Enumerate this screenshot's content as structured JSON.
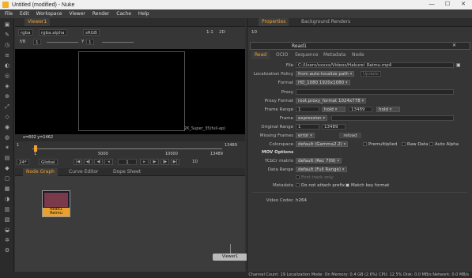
{
  "window": {
    "title": "Untitled (modified) - Nuke",
    "min": "—",
    "max": "☐",
    "close": "✕"
  },
  "menu": [
    "File",
    "Edit",
    "Workspace",
    "Viewer",
    "Render",
    "Cache",
    "Help"
  ],
  "viewer": {
    "tab": "Viewer1",
    "channels": "rgba",
    "layer": "rgba.alpha",
    "colorspace": "sRGB",
    "zoom": "1:1",
    "mode": "2D",
    "fstop": "f/8",
    "one": "1",
    "y": "Y",
    "yval": "1",
    "format_label": "2K_Super_35(full-ap)",
    "coords": "x=602 y=1462",
    "frame_start": "1",
    "frame_end": "13489",
    "ticks": [
      "1",
      "5000",
      "10000",
      "13489"
    ],
    "fps": "24*",
    "global": "Global",
    "current_frame": "1",
    "step": "10"
  },
  "graph_tabs": [
    "Node Graph",
    "Curve Editor",
    "Dope Sheet"
  ],
  "nodes": {
    "read": "Read1",
    "read_sub": "Reimu",
    "viewer": "Viewer1"
  },
  "props_tabs": [
    "Properties",
    "Background Renders"
  ],
  "props": {
    "max_panels": "10",
    "node_name": "Read1",
    "subtabs": [
      "Read",
      "OCIO",
      "Sequence",
      "Metadata",
      "Node"
    ],
    "file_label": "File",
    "file": "C:/Users/xxxxx/Videos/Hakurei_Reimu.mp4",
    "loc_policy_label": "Localization Policy",
    "loc_policy": "from auto-localize path",
    "update": "Update",
    "format_label": "Format",
    "format": "HD_1080 1920x1080",
    "proxy_label": "Proxy",
    "proxy_format_label": "Proxy Format",
    "proxy_format": "root.proxy_format 1024x778",
    "frame_range_label": "Frame Range",
    "range_start": "1",
    "hold1": "hold",
    "range_end": "13489",
    "hold2": "hold",
    "frame_label": "Frame",
    "frame_mode": "expression",
    "orig_range_label": "Original Range",
    "orig_start": "1",
    "orig_end": "13489",
    "missing_label": "Missing Frames",
    "missing": "error",
    "reload": "reload",
    "colorspace_label": "Colorspace",
    "colorspace": "default (Gamma2.2)",
    "premultiplied": "Premultiplied",
    "raw_data": "Raw Data",
    "auto_alpha": "Auto Alpha",
    "mov_options": "MOV Options",
    "ycbcr_label": "YCbCr matrix",
    "ycbcr": "default (Rec 709)",
    "data_range_label": "Data Range",
    "data_range": "default (Full Range)",
    "first_track": "First track only",
    "metadata_label": "Metadata",
    "no_prefix": "Do not attach prefix",
    "match_key": "Match key format",
    "video_codec_label": "Video Codec",
    "video_codec": "h264"
  },
  "status": "Channel Count: 19  Localization Mode: On  Memory: 0.4 GB (2.6%)  CPU: 12.5%  Disk: 0.0 MB/s  Network: 0.0 MB/s"
}
